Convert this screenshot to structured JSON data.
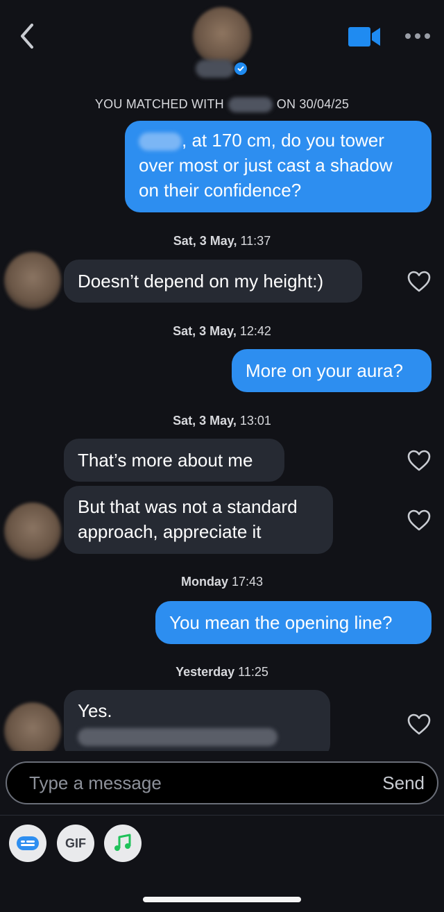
{
  "header": {
    "back_icon": "chevron-left-icon",
    "video_icon": "video-camera-icon",
    "more_icon": "more-dots-icon",
    "verified_icon": "verified-check-icon",
    "accent": "#1f8bf1"
  },
  "match": {
    "prefix": "YOU MATCHED WITH",
    "suffix": "ON 30/04/25"
  },
  "messages": [
    {
      "type": "out",
      "text_after_blur": ", at 170 cm, do you tower",
      "line2": "over most or just cast a shadow",
      "line3": "on their confidence?"
    },
    {
      "type": "timestamp",
      "day": "Sat, 3 May,",
      "time": "11:37"
    },
    {
      "type": "in",
      "text": "Doesn’t depend on my height:)"
    },
    {
      "type": "timestamp",
      "day": "Sat, 3 May,",
      "time": "12:42"
    },
    {
      "type": "out",
      "text": "More on your aura?"
    },
    {
      "type": "timestamp",
      "day": "Sat, 3 May,",
      "time": "13:01"
    },
    {
      "type": "in",
      "text": "That’s more about me"
    },
    {
      "type": "in",
      "line1": "But that was not a standard",
      "line2": "approach, appreciate it"
    },
    {
      "type": "timestamp",
      "day": "Monday",
      "time": "17:43"
    },
    {
      "type": "out",
      "text": "You mean the opening line?"
    },
    {
      "type": "timestamp",
      "day": "Yesterday",
      "time": "11:25"
    },
    {
      "type": "in",
      "text": "Yes."
    }
  ],
  "composer": {
    "placeholder": "Type a message",
    "send_label": "Send"
  },
  "tools": {
    "sticker_icon": "sticker-icon",
    "gif_label": "GIF",
    "music_icon": "music-note-icon"
  },
  "colors": {
    "outgoing_bubble": "#2d8ef0",
    "incoming_bubble": "#262a33",
    "background": "#111217",
    "music_green": "#1fc25a"
  }
}
